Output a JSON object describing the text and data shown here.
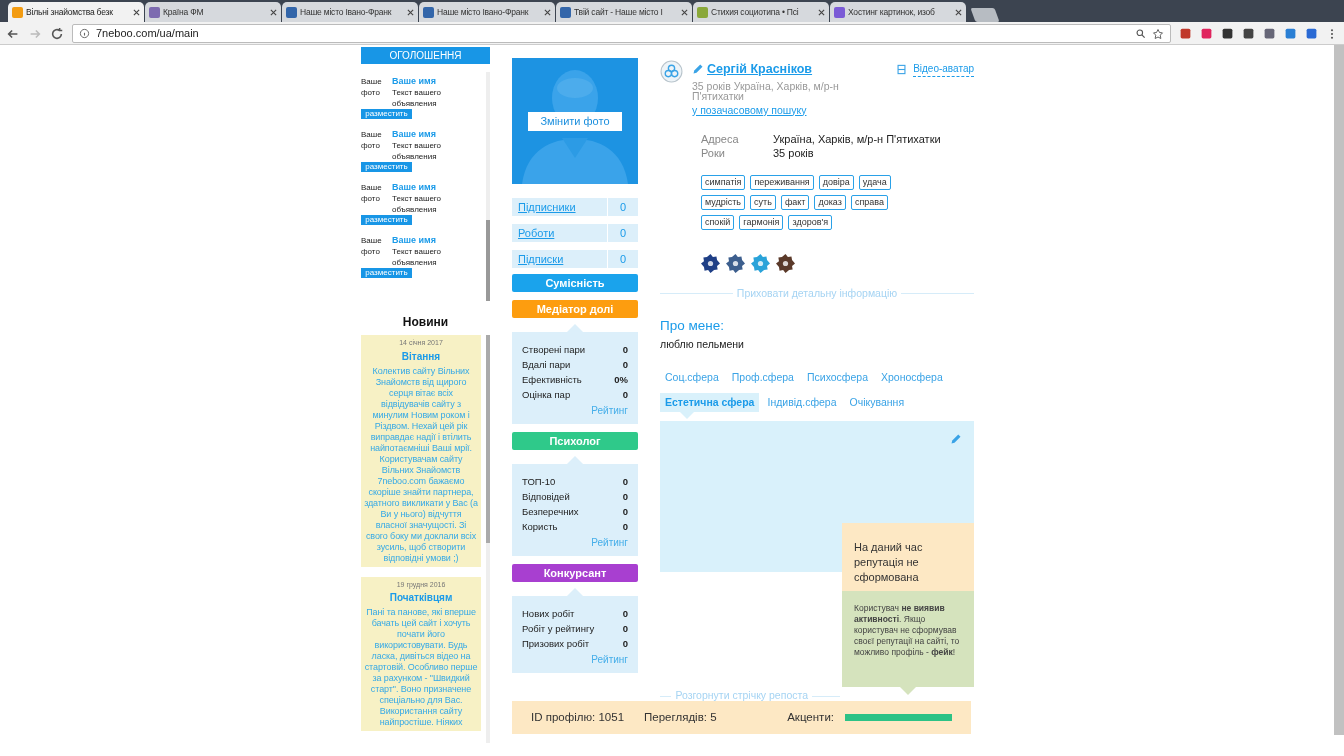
{
  "browser": {
    "tabs": [
      {
        "title": "Вільні знайомства безк",
        "selected": true
      },
      {
        "title": "Країна ФМ",
        "selected": false
      },
      {
        "title": "Наше місто Івано-Франк",
        "selected": false
      },
      {
        "title": "Наше місто Івано-Франк",
        "selected": false
      },
      {
        "title": "Твій сайт - Наше місто І",
        "selected": false
      },
      {
        "title": "Стихия социотипа • Псі",
        "selected": false
      },
      {
        "title": "Хостинг картинок, изоб",
        "selected": false
      }
    ],
    "url": "7neboo.com/ua/main"
  },
  "ads": {
    "header": "ОГОЛОШЕННЯ",
    "items": [
      {
        "photo": "Ваше фото",
        "name": "Ваше имя",
        "text": "Текст вашего объявления",
        "button": "разместить"
      },
      {
        "photo": "Ваше фото",
        "name": "Ваше имя",
        "text": "Текст вашего объявления",
        "button": "разместить"
      },
      {
        "photo": "Ваше фото",
        "name": "Ваше имя",
        "text": "Текст вашего объявления",
        "button": "разместить"
      },
      {
        "photo": "Ваше фото",
        "name": "Ваше имя",
        "text": "Текст вашего объявления",
        "button": "разместить"
      }
    ]
  },
  "news": {
    "title": "Новини",
    "items": [
      {
        "date": "14 січня 2017",
        "title": "Вітання",
        "text": "Колектив сайту Вільних Знайомств від щирого серця вітає всіх відвідувачів сайту з минулим Новим роком і Різдвом. Нехай цей рік виправдає надії і втілить найпотаємніші Ваші мрії. Користувачам сайту Вільних Знайомств 7neboo.com бажаємо скоріше знайти партнера, здатного викликати у Вас (а Ви у нього) відчуття власної значущості. Зі свого боку ми доклали всіх зусиль, щоб створити відповідні умови ;)"
      },
      {
        "date": "19 грудня 2016",
        "title": "Початківцям",
        "text": "Пані та панове, які вперше бачать цей сайт і хочуть почати його використовувати. Будь ласка, дивіться відео на стартовій. Особливо перше за рахунком - \"Швидкий старт\". Воно призначене спеціально для Вас. Використання сайту найпростіше. Ніяких"
      }
    ]
  },
  "photo_button": "Змінити фото",
  "counters": [
    {
      "label": "Підписники",
      "value": "0"
    },
    {
      "label": "Роботи",
      "value": "0"
    },
    {
      "label": "Підписки",
      "value": "0"
    }
  ],
  "sections": [
    {
      "kind": "button",
      "title": "Сумісність",
      "color": "#1aa3ec"
    },
    {
      "kind": "panel",
      "title": "Медіатор долі",
      "color": "#fd9d0f",
      "stats": [
        {
          "label": "Створені пари",
          "value": "0"
        },
        {
          "label": "Вдалі пари",
          "value": "0"
        },
        {
          "label": "Ефективність",
          "value": "0%"
        },
        {
          "label": "Оцінка пар",
          "value": "0"
        }
      ],
      "link": "Рейтинг"
    },
    {
      "kind": "panel",
      "title": "Психолог",
      "color": "#2fc98a",
      "stats": [
        {
          "label": "ТОП-10",
          "value": "0"
        },
        {
          "label": "Відповідей",
          "value": "0"
        },
        {
          "label": "Безперечних",
          "value": "0"
        },
        {
          "label": "Користь",
          "value": "0"
        }
      ],
      "link": "Рейтинг"
    },
    {
      "kind": "panel",
      "title": "Конкурсант",
      "color": "#a83fd0",
      "stats": [
        {
          "label": "Нових робіт",
          "value": "0"
        },
        {
          "label": "Робіт у рейтингу",
          "value": "0"
        },
        {
          "label": "Призових робіт",
          "value": "0"
        }
      ],
      "link": "Рейтинг"
    }
  ],
  "profile": {
    "name": "Сергій Красніков",
    "summary": "35 років Україна, Харків, м/р-н П'ятихатки",
    "search_link": "у позачасовому пошуку",
    "video_avatar": "Відео-аватар",
    "details": [
      {
        "label": "Адреса",
        "value": "Україна, Харків, м/р-н П'ятихатки"
      },
      {
        "label": "Роки",
        "value": "35 років"
      }
    ],
    "tags": [
      "симпатія",
      "переживання",
      "довіра",
      "удача",
      "мудрість",
      "суть",
      "факт",
      "доказ",
      "справа",
      "спокій",
      "гармонія",
      "здоров'я"
    ],
    "socials": [
      {
        "color": "#1f3f86"
      },
      {
        "color": "#3d5f8e"
      },
      {
        "color": "#2aa3d9"
      },
      {
        "color": "#5b3a2a"
      }
    ],
    "hide_link": "Приховати детальну інформацію",
    "about_title": "Про мене:",
    "about_text": "люблю пельмени",
    "tab_rows": [
      [
        {
          "label": "Соц.сфера",
          "selected": false
        },
        {
          "label": "Проф.сфера",
          "selected": false
        },
        {
          "label": "Психосфера",
          "selected": false
        },
        {
          "label": "Хроносфера",
          "selected": false
        }
      ],
      [
        {
          "label": "Естетична сфера",
          "selected": true
        },
        {
          "label": "Індивід.сфера",
          "selected": false
        },
        {
          "label": "Очікування",
          "selected": false
        }
      ]
    ],
    "reputation": {
      "title": "На даний час репутація не сформована",
      "note": "Користувач **не виявив активності**. Якщо користувач не сформував своєї репутації на сайті, то можливо профіль - **фейк**!"
    },
    "repost_link": "Розгорнути стрічку репоста"
  },
  "footer": {
    "id": "ID профілю: 1051",
    "views": "Переглядів: 5",
    "accents": "Акценти:",
    "level": 1
  }
}
